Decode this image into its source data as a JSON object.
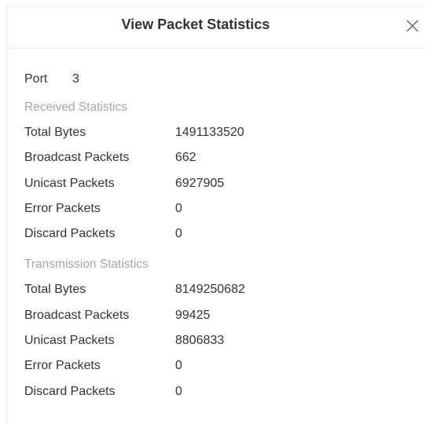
{
  "dialog": {
    "title": "View Packet Statistics"
  },
  "port": {
    "label": "Port",
    "value": "3"
  },
  "received": {
    "title": "Received Statistics",
    "rows": [
      {
        "label": "Total Bytes",
        "value": "1491133520"
      },
      {
        "label": "Broadcast Packets",
        "value": "662"
      },
      {
        "label": "Unicast Packets",
        "value": "6927905"
      },
      {
        "label": "Error Packets",
        "value": "0"
      },
      {
        "label": "Discard Packets",
        "value": "0"
      }
    ]
  },
  "transmission": {
    "title": "Transmission Statistics",
    "rows": [
      {
        "label": "Total Bytes",
        "value": "8149250682"
      },
      {
        "label": "Broadcast Packets",
        "value": "99425"
      },
      {
        "label": "Unicast Packets",
        "value": "8806833"
      },
      {
        "label": "Error Packets",
        "value": "0"
      },
      {
        "label": "Discard Packets",
        "value": "0"
      }
    ]
  },
  "icons": {
    "close": "close-icon"
  }
}
